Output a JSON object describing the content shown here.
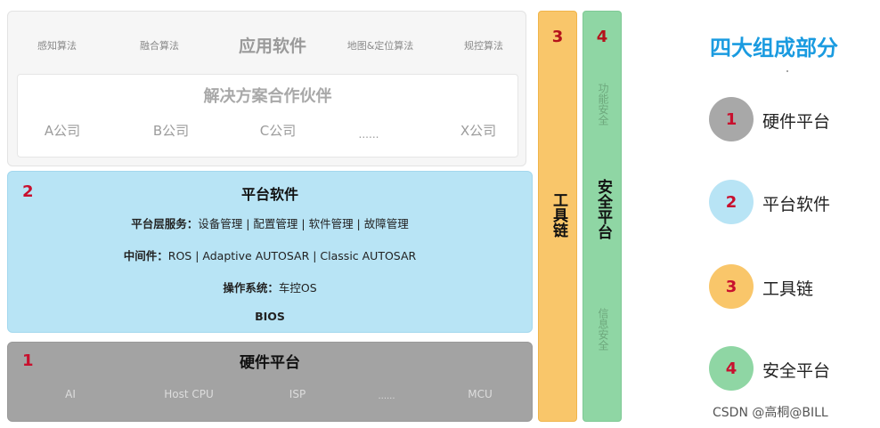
{
  "app_layer": {
    "items": [
      "感知算法",
      "融合算法",
      "应用软件",
      "地图&定位算法",
      "规控算法"
    ],
    "partners_title": "解决方案合作伙伴",
    "partners": [
      "A公司",
      "B公司",
      "C公司",
      "......",
      "X公司"
    ]
  },
  "platform_layer": {
    "number": "2",
    "title": "平台软件",
    "services_label": "平台层服务：",
    "services_value": "设备管理 | 配置管理 | 软件管理 | 故障管理",
    "middleware_label": "中间件：",
    "middleware_value": "ROS | Adaptive AUTOSAR | Classic AUTOSAR",
    "os_label": "操作系统：",
    "os_value": "车控OS",
    "bios": "BIOS"
  },
  "hardware_layer": {
    "number": "1",
    "title": "硬件平台",
    "items": [
      "AI",
      "Host CPU",
      "ISP",
      "......",
      "MCU"
    ]
  },
  "toolchain": {
    "number": "3",
    "label": "工具链"
  },
  "safety": {
    "number": "4",
    "label": "安全平台",
    "functional": "功能安全",
    "info": "信息安全"
  },
  "legend": {
    "title": "四大组成部分",
    "items": [
      {
        "num": "1",
        "label": "硬件平台",
        "color": "#a8a8a8"
      },
      {
        "num": "2",
        "label": "平台软件",
        "color": "#b8e4f5"
      },
      {
        "num": "3",
        "label": "工具链",
        "color": "#f9c66a"
      },
      {
        "num": "4",
        "label": "安全平台",
        "color": "#8fd6a4"
      }
    ]
  },
  "watermark": "CSDN @高桐@BILL"
}
